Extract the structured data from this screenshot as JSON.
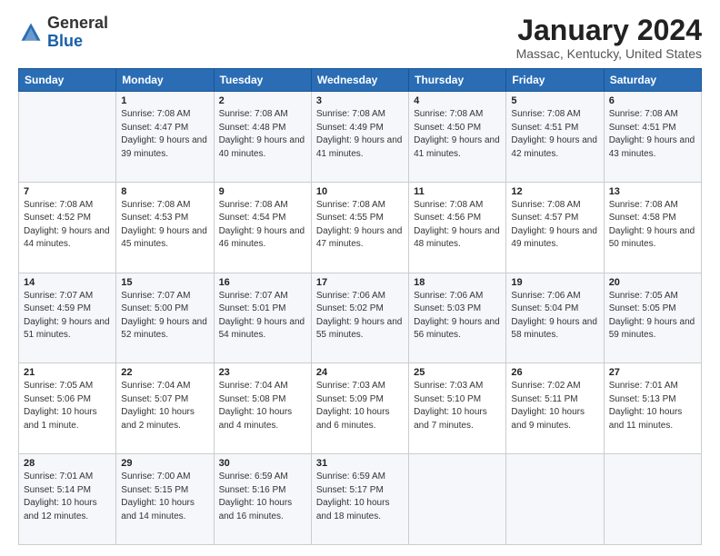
{
  "header": {
    "logo_general": "General",
    "logo_blue": "Blue",
    "month_title": "January 2024",
    "location": "Massac, Kentucky, United States"
  },
  "weekdays": [
    "Sunday",
    "Monday",
    "Tuesday",
    "Wednesday",
    "Thursday",
    "Friday",
    "Saturday"
  ],
  "weeks": [
    [
      {
        "day": "",
        "sunrise": "",
        "sunset": "",
        "daylight": ""
      },
      {
        "day": "1",
        "sunrise": "Sunrise: 7:08 AM",
        "sunset": "Sunset: 4:47 PM",
        "daylight": "Daylight: 9 hours and 39 minutes."
      },
      {
        "day": "2",
        "sunrise": "Sunrise: 7:08 AM",
        "sunset": "Sunset: 4:48 PM",
        "daylight": "Daylight: 9 hours and 40 minutes."
      },
      {
        "day": "3",
        "sunrise": "Sunrise: 7:08 AM",
        "sunset": "Sunset: 4:49 PM",
        "daylight": "Daylight: 9 hours and 41 minutes."
      },
      {
        "day": "4",
        "sunrise": "Sunrise: 7:08 AM",
        "sunset": "Sunset: 4:50 PM",
        "daylight": "Daylight: 9 hours and 41 minutes."
      },
      {
        "day": "5",
        "sunrise": "Sunrise: 7:08 AM",
        "sunset": "Sunset: 4:51 PM",
        "daylight": "Daylight: 9 hours and 42 minutes."
      },
      {
        "day": "6",
        "sunrise": "Sunrise: 7:08 AM",
        "sunset": "Sunset: 4:51 PM",
        "daylight": "Daylight: 9 hours and 43 minutes."
      }
    ],
    [
      {
        "day": "7",
        "sunrise": "Sunrise: 7:08 AM",
        "sunset": "Sunset: 4:52 PM",
        "daylight": "Daylight: 9 hours and 44 minutes."
      },
      {
        "day": "8",
        "sunrise": "Sunrise: 7:08 AM",
        "sunset": "Sunset: 4:53 PM",
        "daylight": "Daylight: 9 hours and 45 minutes."
      },
      {
        "day": "9",
        "sunrise": "Sunrise: 7:08 AM",
        "sunset": "Sunset: 4:54 PM",
        "daylight": "Daylight: 9 hours and 46 minutes."
      },
      {
        "day": "10",
        "sunrise": "Sunrise: 7:08 AM",
        "sunset": "Sunset: 4:55 PM",
        "daylight": "Daylight: 9 hours and 47 minutes."
      },
      {
        "day": "11",
        "sunrise": "Sunrise: 7:08 AM",
        "sunset": "Sunset: 4:56 PM",
        "daylight": "Daylight: 9 hours and 48 minutes."
      },
      {
        "day": "12",
        "sunrise": "Sunrise: 7:08 AM",
        "sunset": "Sunset: 4:57 PM",
        "daylight": "Daylight: 9 hours and 49 minutes."
      },
      {
        "day": "13",
        "sunrise": "Sunrise: 7:08 AM",
        "sunset": "Sunset: 4:58 PM",
        "daylight": "Daylight: 9 hours and 50 minutes."
      }
    ],
    [
      {
        "day": "14",
        "sunrise": "Sunrise: 7:07 AM",
        "sunset": "Sunset: 4:59 PM",
        "daylight": "Daylight: 9 hours and 51 minutes."
      },
      {
        "day": "15",
        "sunrise": "Sunrise: 7:07 AM",
        "sunset": "Sunset: 5:00 PM",
        "daylight": "Daylight: 9 hours and 52 minutes."
      },
      {
        "day": "16",
        "sunrise": "Sunrise: 7:07 AM",
        "sunset": "Sunset: 5:01 PM",
        "daylight": "Daylight: 9 hours and 54 minutes."
      },
      {
        "day": "17",
        "sunrise": "Sunrise: 7:06 AM",
        "sunset": "Sunset: 5:02 PM",
        "daylight": "Daylight: 9 hours and 55 minutes."
      },
      {
        "day": "18",
        "sunrise": "Sunrise: 7:06 AM",
        "sunset": "Sunset: 5:03 PM",
        "daylight": "Daylight: 9 hours and 56 minutes."
      },
      {
        "day": "19",
        "sunrise": "Sunrise: 7:06 AM",
        "sunset": "Sunset: 5:04 PM",
        "daylight": "Daylight: 9 hours and 58 minutes."
      },
      {
        "day": "20",
        "sunrise": "Sunrise: 7:05 AM",
        "sunset": "Sunset: 5:05 PM",
        "daylight": "Daylight: 9 hours and 59 minutes."
      }
    ],
    [
      {
        "day": "21",
        "sunrise": "Sunrise: 7:05 AM",
        "sunset": "Sunset: 5:06 PM",
        "daylight": "Daylight: 10 hours and 1 minute."
      },
      {
        "day": "22",
        "sunrise": "Sunrise: 7:04 AM",
        "sunset": "Sunset: 5:07 PM",
        "daylight": "Daylight: 10 hours and 2 minutes."
      },
      {
        "day": "23",
        "sunrise": "Sunrise: 7:04 AM",
        "sunset": "Sunset: 5:08 PM",
        "daylight": "Daylight: 10 hours and 4 minutes."
      },
      {
        "day": "24",
        "sunrise": "Sunrise: 7:03 AM",
        "sunset": "Sunset: 5:09 PM",
        "daylight": "Daylight: 10 hours and 6 minutes."
      },
      {
        "day": "25",
        "sunrise": "Sunrise: 7:03 AM",
        "sunset": "Sunset: 5:10 PM",
        "daylight": "Daylight: 10 hours and 7 minutes."
      },
      {
        "day": "26",
        "sunrise": "Sunrise: 7:02 AM",
        "sunset": "Sunset: 5:11 PM",
        "daylight": "Daylight: 10 hours and 9 minutes."
      },
      {
        "day": "27",
        "sunrise": "Sunrise: 7:01 AM",
        "sunset": "Sunset: 5:13 PM",
        "daylight": "Daylight: 10 hours and 11 minutes."
      }
    ],
    [
      {
        "day": "28",
        "sunrise": "Sunrise: 7:01 AM",
        "sunset": "Sunset: 5:14 PM",
        "daylight": "Daylight: 10 hours and 12 minutes."
      },
      {
        "day": "29",
        "sunrise": "Sunrise: 7:00 AM",
        "sunset": "Sunset: 5:15 PM",
        "daylight": "Daylight: 10 hours and 14 minutes."
      },
      {
        "day": "30",
        "sunrise": "Sunrise: 6:59 AM",
        "sunset": "Sunset: 5:16 PM",
        "daylight": "Daylight: 10 hours and 16 minutes."
      },
      {
        "day": "31",
        "sunrise": "Sunrise: 6:59 AM",
        "sunset": "Sunset: 5:17 PM",
        "daylight": "Daylight: 10 hours and 18 minutes."
      },
      {
        "day": "",
        "sunrise": "",
        "sunset": "",
        "daylight": ""
      },
      {
        "day": "",
        "sunrise": "",
        "sunset": "",
        "daylight": ""
      },
      {
        "day": "",
        "sunrise": "",
        "sunset": "",
        "daylight": ""
      }
    ]
  ]
}
